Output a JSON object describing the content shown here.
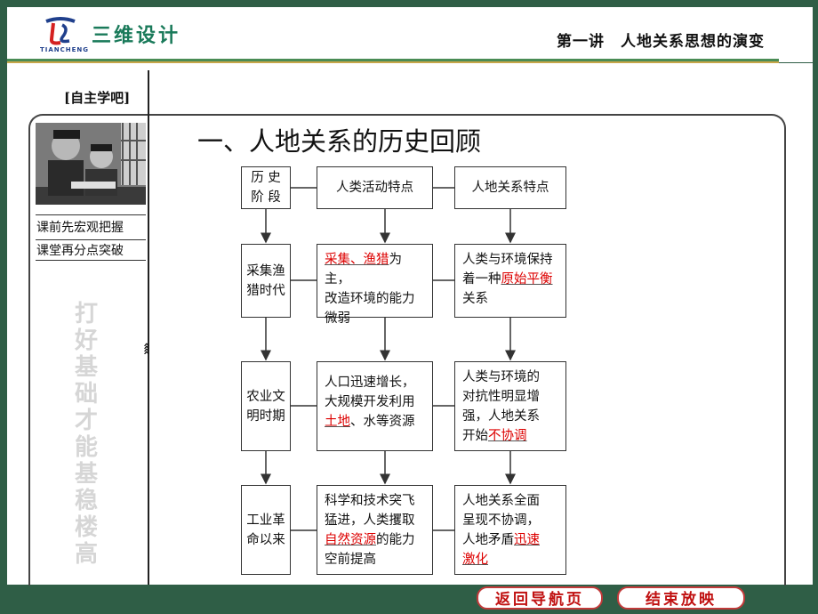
{
  "header": {
    "logo_text": "TIANCHENG",
    "brand": "三维设计",
    "lecture_title": "第一讲　人地关系思想的演变"
  },
  "sidebar": {
    "tag": "[自主学吧]",
    "caption_line1": "课前先宏观把握",
    "caption_line2": "课堂再分点突破",
    "vertical_slogan": "打好基础才能基稳楼高",
    "expand_glyph": "«"
  },
  "main": {
    "section_title": "一、人地关系的历史回顾",
    "headers": {
      "col1": "历 史\n阶 段",
      "col2": "人类活动特点",
      "col3": "人地关系特点"
    },
    "rows": [
      {
        "period": "采集渔\n猎时代",
        "activity_red": "采集、渔猎",
        "activity_rest1": "为主，",
        "activity_rest2": "改造环境的能力",
        "activity_rest3": "微弱",
        "relation1": "人类与环境保持",
        "relation2_pre": "着一种",
        "relation2_red": "原始平衡",
        "relation3": "关系"
      },
      {
        "period": "农业文\n明时期",
        "activity1": "人口迅速增长，",
        "activity2": "大规模开发利用",
        "activity3_red": "土地",
        "activity3_rest": "、水等资源",
        "relation1": "人类与环境的",
        "relation2": "对抗性明显增",
        "relation3": "强，人地关系",
        "relation4_pre": "开始",
        "relation4_red": "不协调"
      },
      {
        "period": "工业革\n命以来",
        "activity1": "科学和技术突飞",
        "activity2": "猛进，人类攫取",
        "activity3_red": "自然资源",
        "activity3_rest": "的能力",
        "activity4": "空前提高",
        "relation1": "人地关系全面",
        "relation2": "呈现不协调，",
        "relation3_pre": "人地矛盾",
        "relation3_red": "迅速",
        "relation4_red": "激化"
      }
    ]
  },
  "footer": {
    "back_button": "返回导航页",
    "end_button": "结束放映"
  },
  "colors": {
    "background": "#2f5e46",
    "brand": "#1a7a5a",
    "highlight": "#dd0000",
    "button_text": "#c01010"
  }
}
